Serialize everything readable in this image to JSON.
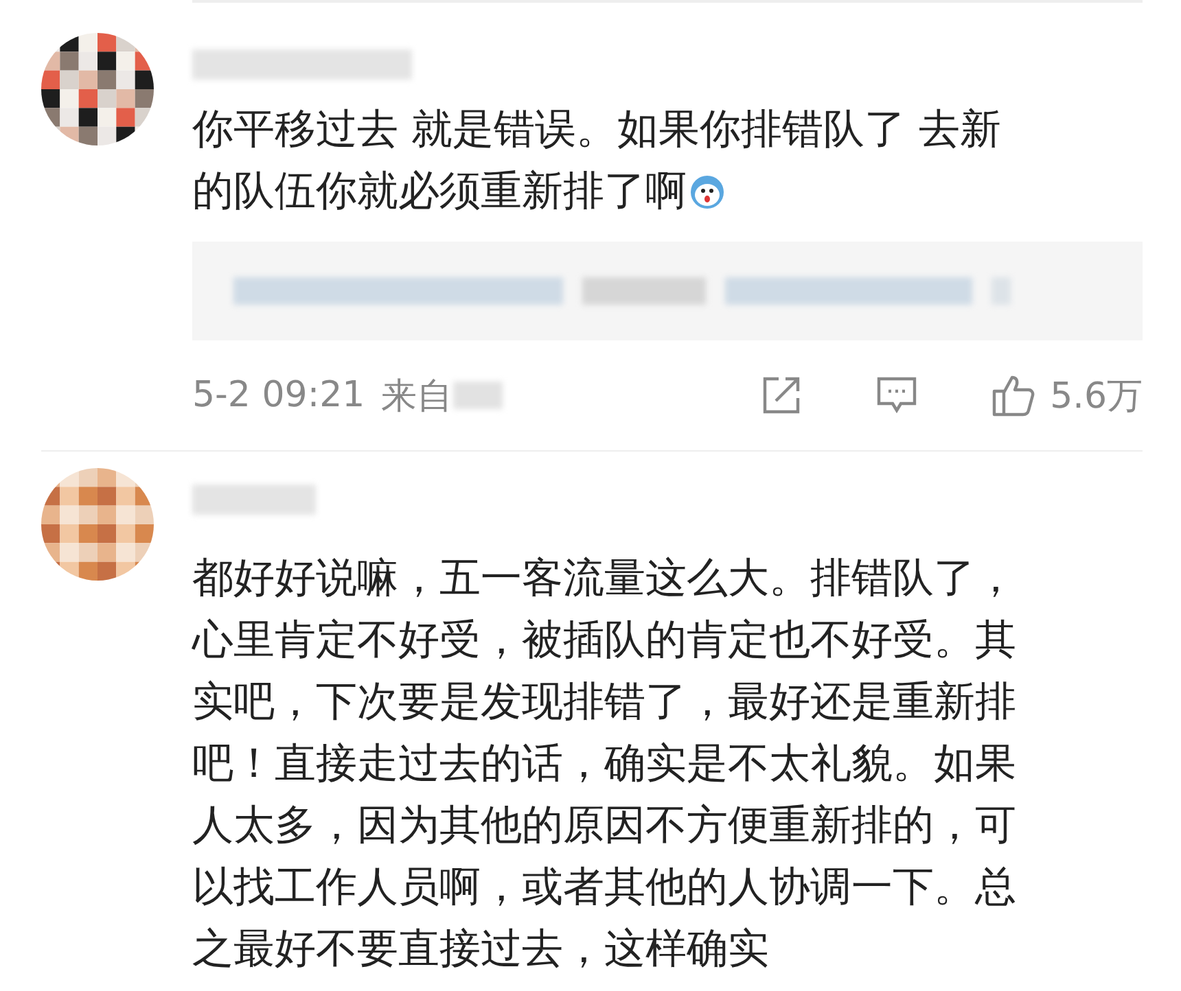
{
  "comments": [
    {
      "lines": [
        "你平移过去 就是错误。如果你排错队了 去新",
        "的队伍你就必须重新排了啊"
      ],
      "emoji": true,
      "quoted": true,
      "footer": {
        "time": "5-2 09:21",
        "source": "来自",
        "likes": "5.6万"
      }
    },
    {
      "lines": [
        "都好好说嘛，五一客流量这么大。排错队了，",
        "心里肯定不好受，被插队的肯定也不好受。其",
        "实吧，下次要是发现排错了，最好还是重新排",
        "吧！直接走过去的话，确实是不太礼貌。如果",
        "人太多，因为其他的原因不方便重新排的，可",
        "以找工作人员啊，或者其他的人协调一下。总",
        "之最好不要直接过去，这样确实"
      ],
      "emoji": false,
      "quoted": false
    }
  ]
}
